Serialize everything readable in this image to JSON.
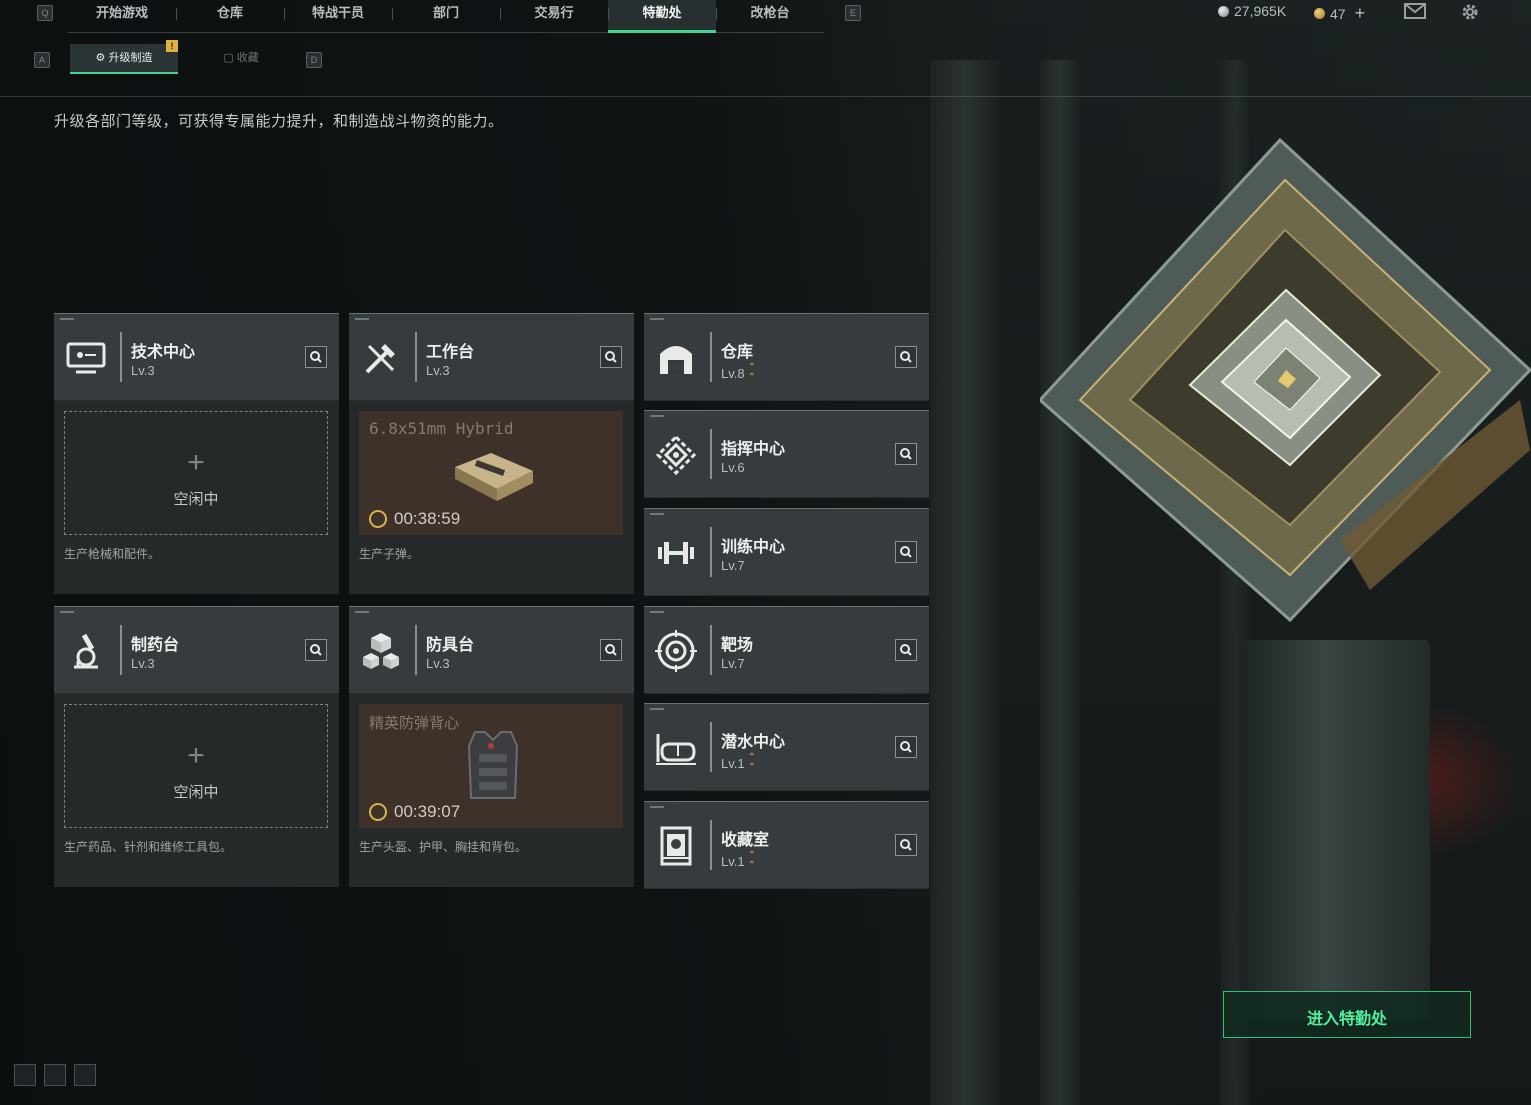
{
  "nav": {
    "left_key": "Q",
    "right_key": "E",
    "tabs": [
      {
        "label": "开始游戏"
      },
      {
        "label": "仓库"
      },
      {
        "label": "特战干员"
      },
      {
        "label": "部门"
      },
      {
        "label": "交易行"
      },
      {
        "label": "特勤处",
        "active": true
      },
      {
        "label": "改枪台"
      }
    ],
    "currency_1": "27,965K",
    "currency_2": "47",
    "add_symbol": "+"
  },
  "subnav": {
    "left_key": "A",
    "right_key": "D",
    "tabs": [
      {
        "label": "升级制造",
        "active": true
      },
      {
        "label": "收藏"
      }
    ],
    "warning_badge": "!"
  },
  "description": "升级各部门等级，可获得专属能力提升，和制造战斗物资的能力。",
  "departments": [
    {
      "name": "技术中心",
      "level": "Lv.3",
      "icon": "computer-icon"
    },
    {
      "name": "工作台",
      "level": "Lv.3",
      "icon": "tools-icon"
    },
    {
      "name": "制药台",
      "level": "Lv.3",
      "icon": "microscope-icon"
    },
    {
      "name": "防具台",
      "level": "Lv.3",
      "icon": "cubes-icon"
    },
    {
      "name": "仓库",
      "level": "Lv.8",
      "icon": "warehouse-icon",
      "upgradable": true
    },
    {
      "name": "指挥中心",
      "level": "Lv.6",
      "icon": "command-icon"
    },
    {
      "name": "训练中心",
      "level": "Lv.7",
      "icon": "dumbbell-icon"
    },
    {
      "name": "靶场",
      "level": "Lv.7",
      "icon": "target-icon"
    },
    {
      "name": "潜水中心",
      "level": "Lv.1",
      "icon": "diving-mask-icon",
      "upgradable": true
    },
    {
      "name": "收藏室",
      "level": "Lv.1",
      "icon": "display-case-icon",
      "upgradable": true
    }
  ],
  "production": [
    {
      "status": "空闲中",
      "plus": "+",
      "desc": "生产枪械和配件。"
    },
    {
      "item": "6.8x51mm Hybrid",
      "timer": "00:38:59",
      "desc": "生产子弹。"
    },
    {
      "status": "空闲中",
      "plus": "+",
      "desc": "生产药品、针剂和维修工具包。"
    },
    {
      "item": "精英防弹背心",
      "timer": "00:39:07",
      "desc": "生产头盔、护甲、胸挂和背包。"
    }
  ],
  "enter_button": "进入特勤处",
  "colors": {
    "accent": "#3dd68c",
    "gold": "#d9ad4a",
    "busy_slot": "#3e3129"
  }
}
